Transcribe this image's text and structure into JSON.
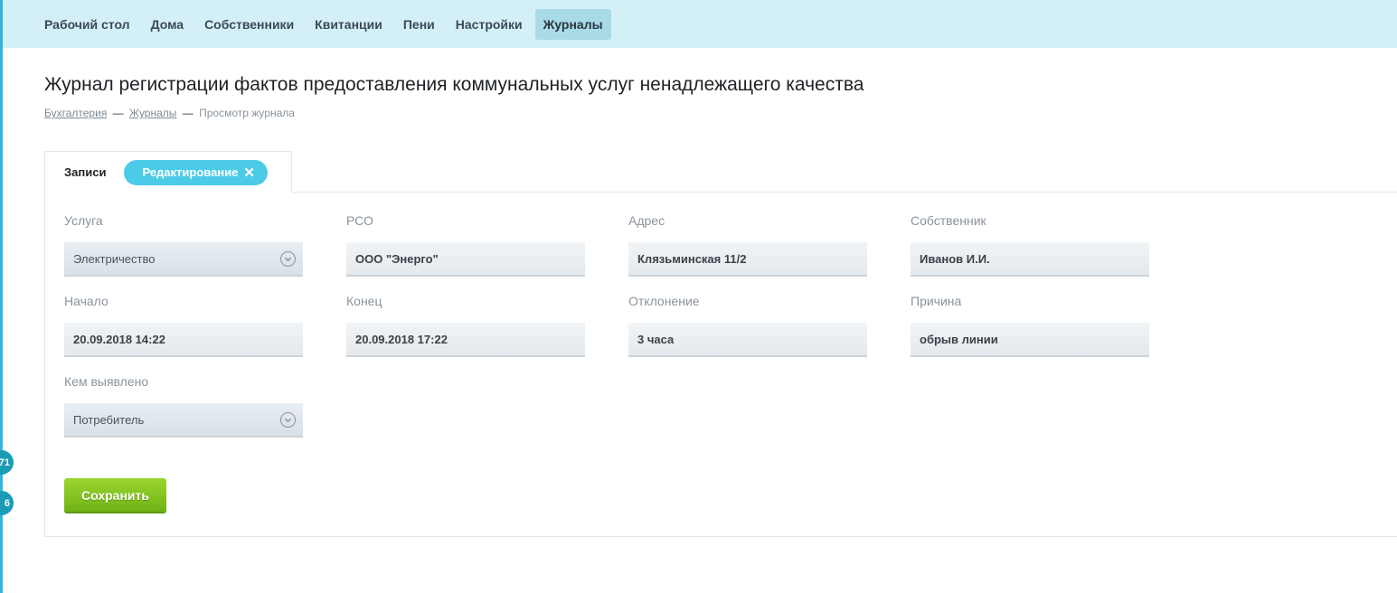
{
  "nav": {
    "items": [
      {
        "label": "Рабочий стол"
      },
      {
        "label": "Дома"
      },
      {
        "label": "Собственники"
      },
      {
        "label": "Квитанции"
      },
      {
        "label": "Пени"
      },
      {
        "label": "Настройки"
      },
      {
        "label": "Журналы",
        "active": true
      }
    ]
  },
  "page": {
    "title": "Журнал регистрации фактов предоставления коммунальных услуг ненадлежащего качества"
  },
  "breadcrumb": {
    "items": [
      "Бухгалтерия",
      "Журналы",
      "Просмотр журнала"
    ],
    "separator": "—"
  },
  "tabs": {
    "records": "Записи",
    "edit": "Редактирование",
    "close_glyph": "✕"
  },
  "form": {
    "service": {
      "label": "Услуга",
      "value": "Электричество"
    },
    "rso": {
      "label": "РСО",
      "value": "ООО \"Энерго\""
    },
    "address": {
      "label": "Адрес",
      "value": "Клязьминская 11/2"
    },
    "owner": {
      "label": "Собственник",
      "value": "Иванов И.И."
    },
    "start": {
      "label": "Начало",
      "value": "20.09.2018 14:22"
    },
    "end": {
      "label": "Конец",
      "value": "20.09.2018 17:22"
    },
    "deviation": {
      "label": "Отклонение",
      "value": "3 часа"
    },
    "reason": {
      "label": "Причина",
      "value": "обрыв линии"
    },
    "detected_by": {
      "label": "Кем выявлено",
      "value": "Потребитель"
    }
  },
  "actions": {
    "save_label": "Сохранить"
  },
  "badges": [
    "71",
    "6"
  ],
  "colors": {
    "nav_bg": "#d4f0f7",
    "accent": "#4ccbe8",
    "save": "#7fc11f"
  }
}
